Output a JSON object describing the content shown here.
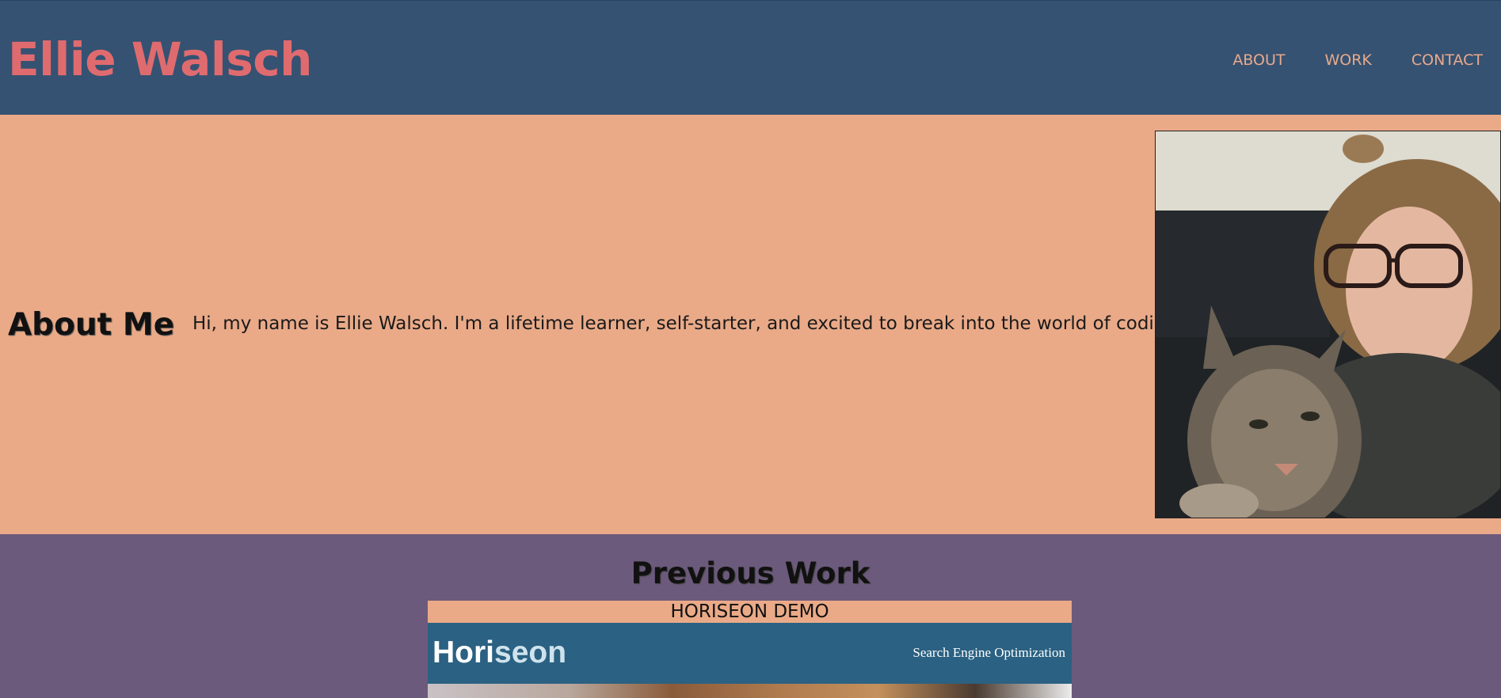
{
  "header": {
    "title": "Ellie Walsch",
    "nav": [
      "ABOUT",
      "WORK",
      "CONTACT"
    ]
  },
  "about": {
    "heading": "About Me",
    "text": "Hi, my name is Ellie Walsch. I'm a lifetime learner, self-starter, and excited to break into the world of coding!",
    "photo_icon": "profile-photo-with-cat"
  },
  "work": {
    "heading": "Previous Work",
    "projects": [
      {
        "label": "HORISEON DEMO",
        "brand_part1": "Hori",
        "brand_part2": "seon",
        "tagline": "Search Engine Optimization"
      }
    ]
  },
  "colors": {
    "header_bg": "#355272",
    "title": "#e06b6f",
    "nav": "#e9a98a",
    "about_bg": "#eaaa88",
    "work_bg": "#6c5a7c",
    "horiseon_bg": "#2b6182"
  }
}
